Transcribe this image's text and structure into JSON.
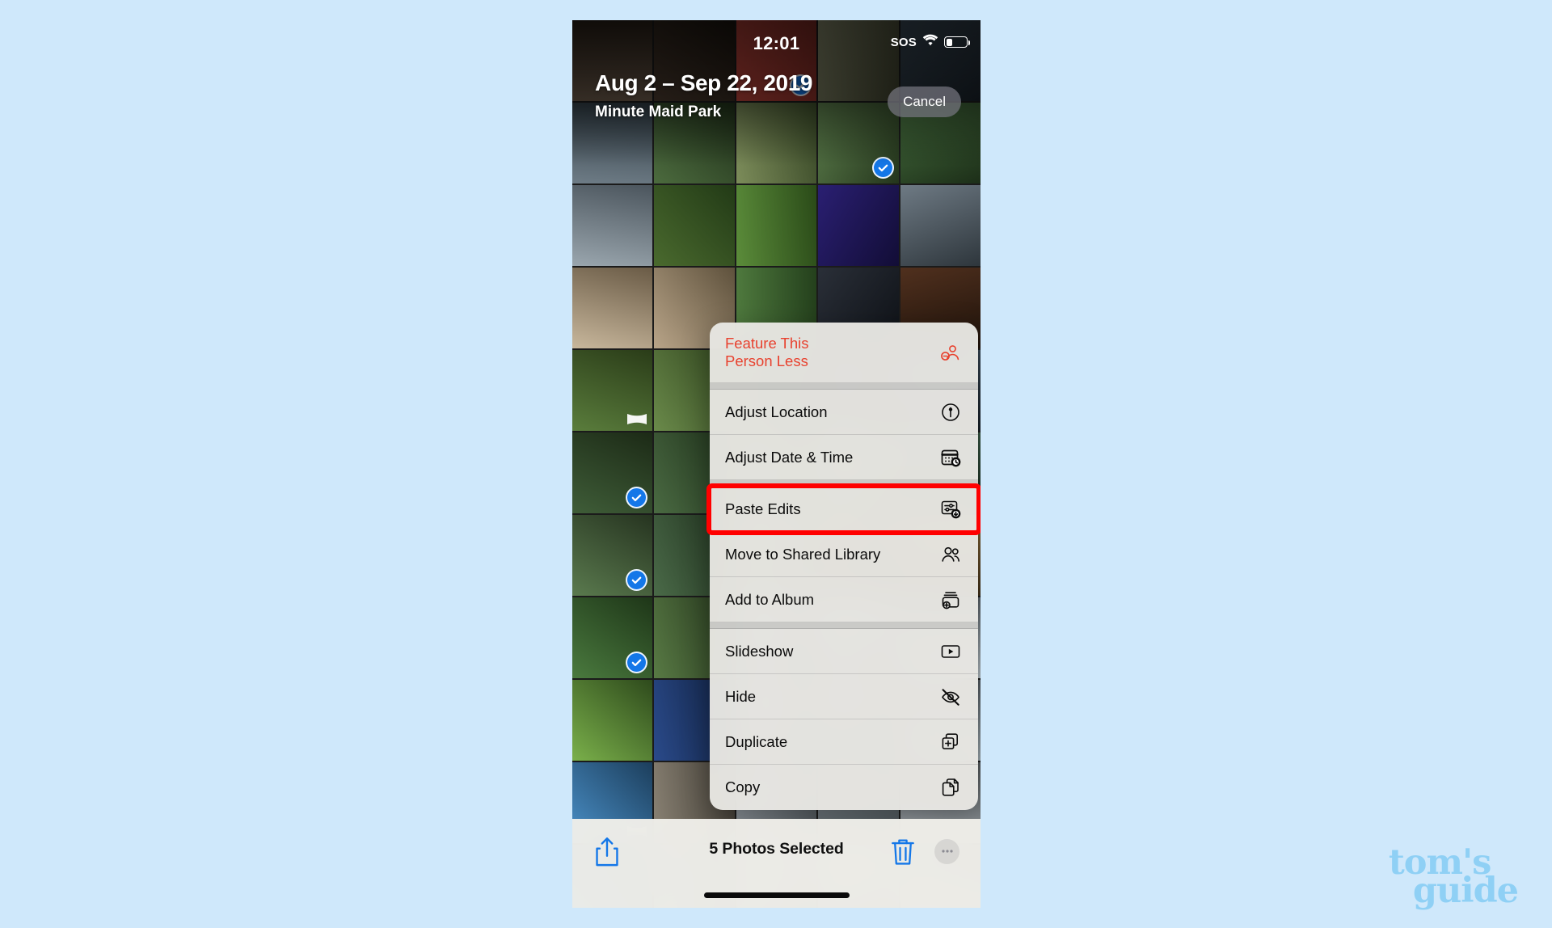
{
  "app": "Photos",
  "background_color": "#cfe8fb",
  "status_bar": {
    "time": "12:01",
    "sos_label": "SOS",
    "wifi_icon": "wifi-icon",
    "battery_icon": "battery-icon",
    "battery_level_percent": 33
  },
  "header": {
    "date_range": "Aug 2 – Sep 22, 2019",
    "place": "Minute Maid Park",
    "cancel_label": "Cancel"
  },
  "context_menu": {
    "items": [
      {
        "label": "Feature This\nPerson Less",
        "icon": "person-minus-icon",
        "destructive": true,
        "separator_after": true,
        "highlighted": false
      },
      {
        "label": "Adjust Location",
        "icon": "location-pin-circle-icon",
        "destructive": false,
        "separator_after": false,
        "highlighted": false
      },
      {
        "label": "Adjust Date & Time",
        "icon": "calendar-clock-icon",
        "destructive": false,
        "separator_after": true,
        "highlighted": false
      },
      {
        "label": "Paste Edits",
        "icon": "paste-edits-icon",
        "destructive": false,
        "separator_after": false,
        "highlighted": true
      },
      {
        "label": "Move to Shared Library",
        "icon": "people-icon",
        "destructive": false,
        "separator_after": false,
        "highlighted": false
      },
      {
        "label": "Add to Album",
        "icon": "album-add-icon",
        "destructive": false,
        "separator_after": true,
        "highlighted": false
      },
      {
        "label": "Slideshow",
        "icon": "play-rect-icon",
        "destructive": false,
        "separator_after": false,
        "highlighted": false
      },
      {
        "label": "Hide",
        "icon": "eye-slash-icon",
        "destructive": false,
        "separator_after": false,
        "highlighted": false
      },
      {
        "label": "Duplicate",
        "icon": "duplicate-icon",
        "destructive": false,
        "separator_after": false,
        "highlighted": false
      },
      {
        "label": "Copy",
        "icon": "copy-icon",
        "destructive": false,
        "separator_after": false,
        "highlighted": false
      }
    ],
    "highlight_color": "#ff0000",
    "destructive_color": "#e8422f"
  },
  "toolbar": {
    "share_icon": "share-icon",
    "selection_text": "5 Photos Selected",
    "trash_icon": "trash-icon",
    "more_icon": "more-ellipsis-icon",
    "accent_color": "#1477e8"
  },
  "photo_grid": {
    "columns": 5,
    "selected_count": 5,
    "selection_badge_color": "#1477e8",
    "cells": [
      {
        "c1": "#6b5a4a",
        "c2": "#2a2018",
        "sel": false,
        "pano": false
      },
      {
        "c1": "#4a3a2e",
        "c2": "#1a140e",
        "sel": false,
        "pano": false
      },
      {
        "c1": "#b9433a",
        "c2": "#7d2a23",
        "sel": true,
        "pano": false
      },
      {
        "c1": "#8a8d6e",
        "c2": "#3a3d2a",
        "sel": false,
        "pano": false
      },
      {
        "c1": "#3d4d5a",
        "c2": "#182028",
        "sel": false,
        "pano": false
      },
      {
        "c1": "#6e7c86",
        "c2": "#2c3840",
        "sel": false,
        "pano": false
      },
      {
        "c1": "#4c6b3e",
        "c2": "#1e2e18",
        "sel": false,
        "pano": false
      },
      {
        "c1": "#7c8c5a",
        "c2": "#3a4a28",
        "sel": false,
        "pano": false
      },
      {
        "c1": "#5a7b4a",
        "c2": "#24351c",
        "sel": true,
        "pano": false
      },
      {
        "c1": "#47703f",
        "c2": "#1c2e18",
        "sel": false,
        "pano": false
      },
      {
        "c1": "#9aa6ae",
        "c2": "#4b555d",
        "sel": false,
        "pano": false
      },
      {
        "c1": "#4a6a2e",
        "c2": "#223a16",
        "sel": false,
        "pano": false
      },
      {
        "c1": "#5b8c3a",
        "c2": "#2a4a18",
        "sel": false,
        "pano": false
      },
      {
        "c1": "#2a1f72",
        "c2": "#120d36",
        "sel": false,
        "pano": false
      },
      {
        "c1": "#6e7a84",
        "c2": "#2e363c",
        "sel": false,
        "pano": false
      },
      {
        "c1": "#c8b79c",
        "c2": "#6a5b46",
        "sel": false,
        "pano": false
      },
      {
        "c1": "#b8a488",
        "c2": "#5e513c",
        "sel": false,
        "pano": false
      },
      {
        "c1": "#4f7a3e",
        "c2": "#24401c",
        "sel": false,
        "pano": false
      },
      {
        "c1": "#2a2f38",
        "c2": "#0e1116",
        "sel": false,
        "pano": false
      },
      {
        "c1": "#50301e",
        "c2": "#1e120a",
        "sel": false,
        "pano": false
      },
      {
        "c1": "#5a7d3c",
        "c2": "#2a3c18",
        "sel": false,
        "pano": true
      },
      {
        "c1": "#6a8a4a",
        "c2": "#30441e",
        "sel": false,
        "pano": false
      },
      {
        "c1": "#3f5a2e",
        "c2": "#1a2614",
        "sel": false,
        "pano": false
      },
      {
        "c1": "#2c3a46",
        "c2": "#101820",
        "sel": false,
        "pano": false
      },
      {
        "c1": "#3a4a58",
        "c2": "#161e26",
        "sel": false,
        "pano": false
      },
      {
        "c1": "#3f5d38",
        "c2": "#1c2a16",
        "sel": true,
        "pano": false
      },
      {
        "c1": "#4a6a42",
        "c2": "#1e301a",
        "sel": false,
        "pano": false
      },
      {
        "c1": "#567a4a",
        "c2": "#26381e",
        "sel": false,
        "pano": false
      },
      {
        "c1": "#6b8a52",
        "c2": "#2e3e22",
        "sel": false,
        "pano": false
      },
      {
        "c1": "#3a5a46",
        "c2": "#16261c",
        "sel": false,
        "pano": false
      },
      {
        "c1": "#5a7a4e",
        "c2": "#263420",
        "sel": true,
        "pano": false
      },
      {
        "c1": "#4a6a48",
        "c2": "#1e2e1c",
        "sel": false,
        "pano": false
      },
      {
        "c1": "#7a8a58",
        "c2": "#3a4226",
        "sel": false,
        "pano": false
      },
      {
        "c1": "#6a5a3a",
        "c2": "#2e2618",
        "sel": false,
        "pano": false
      },
      {
        "c1": "#8a6a3a",
        "c2": "#3e2e18",
        "sel": false,
        "pano": false
      },
      {
        "c1": "#4a7a3e",
        "c2": "#1e3618",
        "sel": true,
        "pano": false
      },
      {
        "c1": "#587a44",
        "c2": "#24341c",
        "sel": false,
        "pano": false
      },
      {
        "c1": "#9aa8b0",
        "c2": "#4a545a",
        "sel": false,
        "pano": false
      },
      {
        "c1": "#aab4ba",
        "c2": "#525c62",
        "sel": false,
        "pano": false
      },
      {
        "c1": "#b0bac0",
        "c2": "#565e64",
        "sel": false,
        "pano": false
      },
      {
        "c1": "#7ab04a",
        "c2": "#2e4a1c",
        "sel": false,
        "pano": false
      },
      {
        "c1": "#2a4a8a",
        "c2": "#10203e",
        "sel": false,
        "pano": false
      },
      {
        "c1": "#98a4ac",
        "c2": "#4a5258",
        "sel": false,
        "pano": false
      },
      {
        "c1": "#8e9aa2",
        "c2": "#444c52",
        "sel": false,
        "pano": false
      },
      {
        "c1": "#a2aeb4",
        "c2": "#4e565c",
        "sel": false,
        "pano": false
      },
      {
        "c1": "#4a90c8",
        "c2": "#1c3e5c",
        "sel": false,
        "pano": true
      },
      {
        "c1": "#8a8274",
        "c2": "#403c34",
        "sel": false,
        "pano": false
      },
      {
        "c1": "#9aa2a8",
        "c2": "#4a5054",
        "sel": false,
        "pano": false
      },
      {
        "c1": "#8c949a",
        "c2": "#424a4e",
        "sel": false,
        "pano": false
      },
      {
        "c1": "#a4aab0",
        "c2": "#505658",
        "sel": false,
        "pano": false
      },
      {
        "c1": "#3e86c4",
        "c2": "#184060",
        "sel": false,
        "pano": false
      },
      {
        "c1": "#6a8a9a",
        "c2": "#2e3e48",
        "sel": false,
        "pano": false
      },
      {
        "c1": "#8a9aa4",
        "c2": "#404a50",
        "sel": false,
        "pano": false
      },
      {
        "c1": "#96a0a6",
        "c2": "#484e52",
        "sel": false,
        "pano": false
      },
      {
        "c1": "#a0a8ae",
        "c2": "#4c5256",
        "sel": false,
        "pano": false
      }
    ]
  },
  "watermark": {
    "line1": "tom's",
    "line2": "guide",
    "color": "#8fd0f5"
  }
}
